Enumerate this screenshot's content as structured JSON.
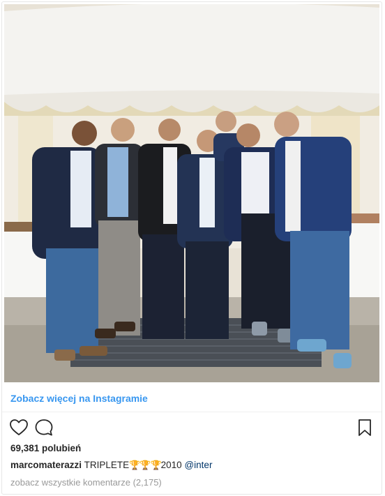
{
  "post": {
    "view_more_label": "Zobacz więcej na Instagramie",
    "likes_label": "69,381 polubień",
    "caption": {
      "username": "marcomaterazzi",
      "text": "TRIPLETE",
      "trophies": "🏆🏆🏆",
      "year": "2010",
      "mention": "@inter"
    },
    "view_all_comments": "zobacz wszystkie komentarze (2,175)"
  },
  "icons": {
    "like": "heart-outline",
    "comment": "speech-bubble-outline",
    "save": "bookmark-outline"
  },
  "colors": {
    "link": "#3897f0",
    "text": "#262626",
    "muted": "#999999",
    "mention": "#003569"
  }
}
